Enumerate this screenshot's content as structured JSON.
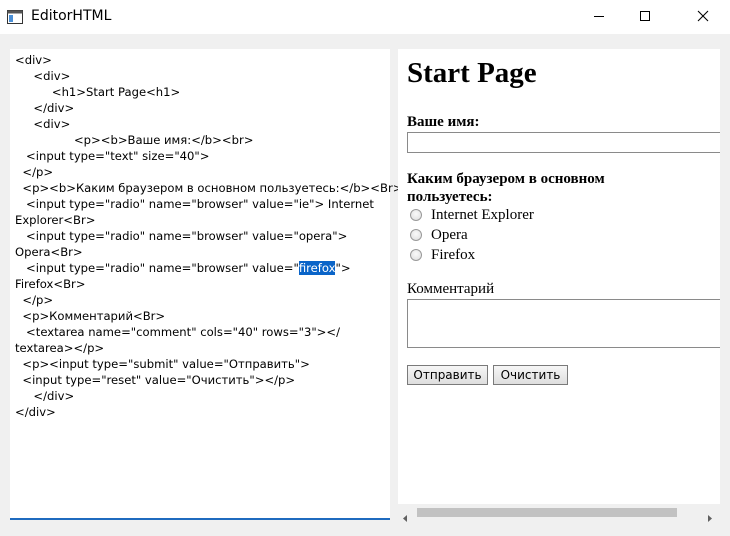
{
  "window": {
    "title": "EditorHTML",
    "icon": "app-window-icon",
    "controls": [
      "minimize-icon",
      "maximize-icon",
      "close-icon"
    ]
  },
  "editor": {
    "lines_before_selection": [
      "<div>",
      "     <div>",
      "          <h1>Start Page<h1>",
      "     </div>",
      "     <div>",
      "                <p><b>Ваше имя:</b><br>",
      "   <input type=\"text\" size=\"40\">",
      "  </p>",
      "  <p><b>Каким браузером в основном пользуетесь:</b><Br>",
      "   <input type=\"radio\" name=\"browser\" value=\"ie\"> Internet",
      "Explorer<Br>",
      "   <input type=\"radio\" name=\"browser\" value=\"opera\">",
      "Opera<Br>"
    ],
    "selection_line_prefix": "   <input type=\"radio\" name=\"browser\" value=\"",
    "selected_text": "firefox",
    "selection_line_suffix": "\">",
    "lines_after_selection": [
      "Firefox<Br>",
      "  </p>",
      "  <p>Комментарий<Br>",
      "   <textarea name=\"comment\" cols=\"40\" rows=\"3\"></",
      "textarea></p>",
      "  <p><input type=\"submit\" value=\"Отправить\">",
      "  <input type=\"reset\" value=\"Очистить\"></p>",
      "     </div>",
      "</div>"
    ]
  },
  "preview": {
    "heading": "Start Page",
    "name_label": "Ваше имя:",
    "name_value": "",
    "browser_label": "Каким браузером в основном пользуетесь:",
    "browser_options": [
      "Internet Explorer",
      "Opera",
      "Firefox"
    ],
    "comment_label": "Комментарий",
    "comment_value": "",
    "submit_label": "Отправить",
    "reset_label": "Очистить"
  },
  "colors": {
    "selection": "#0a64c8",
    "editor_focus_border": "#1f6bbf"
  }
}
